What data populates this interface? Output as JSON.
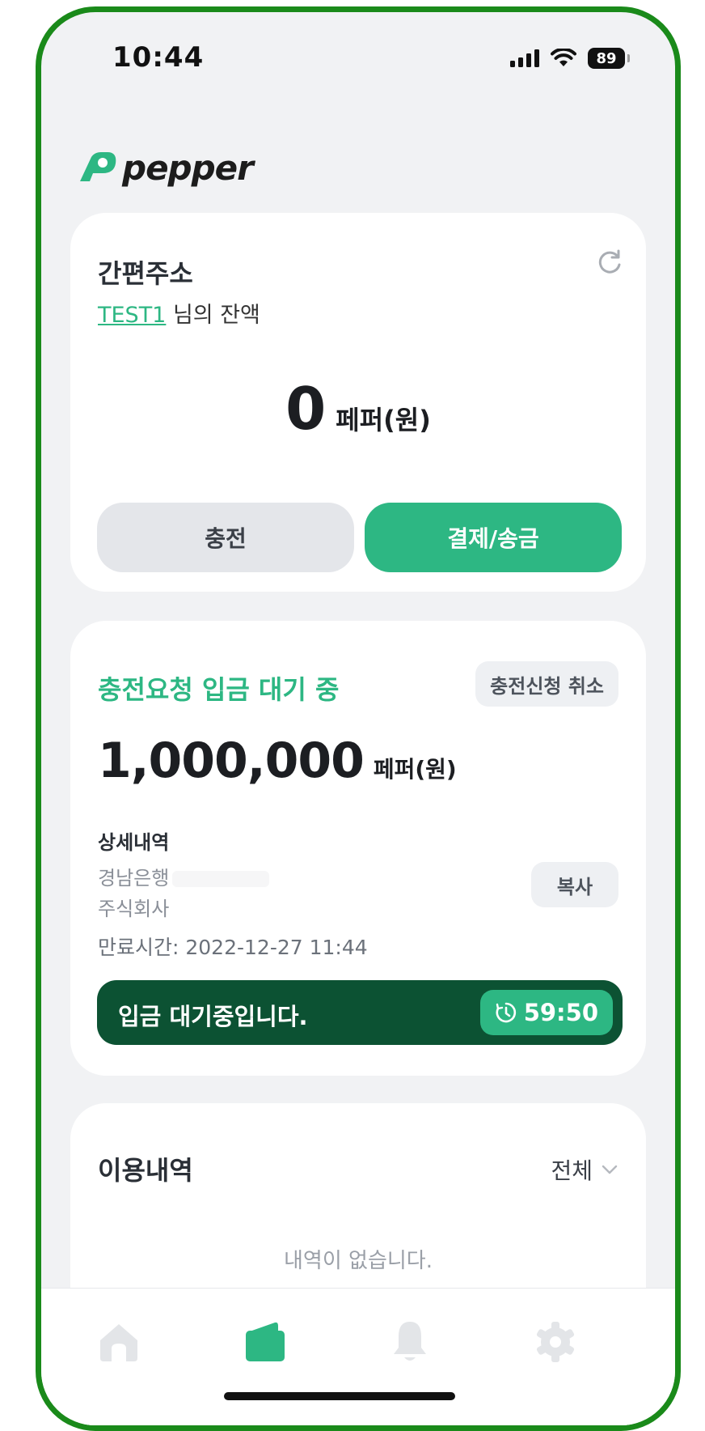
{
  "status_bar": {
    "time": "10:44",
    "battery": "89"
  },
  "brand": {
    "name": "pepper",
    "color": "#2db783"
  },
  "balance_card": {
    "title": "간편주소",
    "owner_name": "TEST1",
    "owner_suffix": " 님의 잔액",
    "amount": "0",
    "unit": "페퍼(원)",
    "charge_label": "충전",
    "pay_label": "결제/송금"
  },
  "pending_card": {
    "title": "충전요청 입금 대기 중",
    "cancel_label": "충전신청 취소",
    "amount": "1,000,000",
    "unit": "페퍼(원)",
    "detail_heading": "상세내역",
    "bank": "경남은행",
    "holder": "주식회사",
    "copy_label": "복사",
    "expiry": "만료시간: 2022-12-27 11:44",
    "waiting_text": "입금 대기중입니다.",
    "timer": "59:50"
  },
  "history_card": {
    "title": "이용내역",
    "filter_label": "전체",
    "empty_text": "내역이 없습니다."
  },
  "tab_bar": {
    "items": [
      {
        "icon": "home-icon",
        "active": false
      },
      {
        "icon": "wallet-icon",
        "active": true
      },
      {
        "icon": "bell-icon",
        "active": false
      },
      {
        "icon": "gear-icon",
        "active": false
      }
    ],
    "active_color": "#2db783",
    "inactive_color": "#e3e5e8"
  }
}
